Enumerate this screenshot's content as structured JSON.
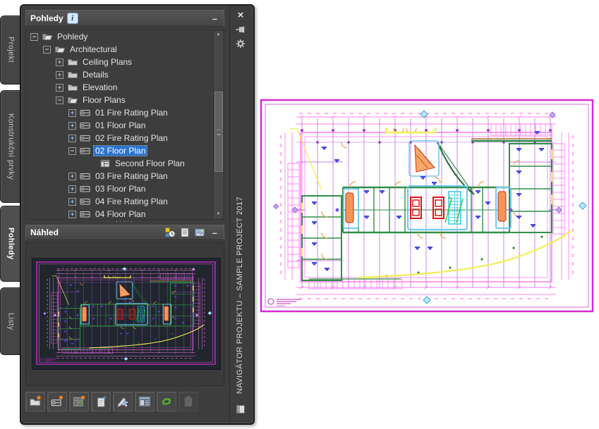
{
  "glyphs": {
    "plus": "+",
    "minus": "−",
    "collapse": "–",
    "splitter": "·····",
    "scroll_up": "▲",
    "scroll_down": "▼",
    "close": "×",
    "info": "i"
  },
  "palette": {
    "header": {
      "title": "Pohledy"
    },
    "side_tabs": [
      {
        "label": "Projekt"
      },
      {
        "label": "Konstrukční prvky"
      },
      {
        "label": "Pohledy"
      },
      {
        "label": "Listy"
      }
    ],
    "active_tab": "Pohledy",
    "title_strip": {
      "text": "NAVIGÁTOR PROJEKTU – SAMPLE PROJECT 2017",
      "icons": [
        "close-icon",
        "pin-icon",
        "gear-icon",
        "autohide-icon"
      ]
    },
    "tree": {
      "items": [
        {
          "label": "Pohledy",
          "level": 0,
          "expander": "minus",
          "icon": "folder-open"
        },
        {
          "label": "Architectural",
          "level": 1,
          "expander": "minus",
          "icon": "folder-open"
        },
        {
          "label": "Ceiling Plans",
          "level": 2,
          "expander": "plus",
          "icon": "folder-closed"
        },
        {
          "label": "Details",
          "level": 2,
          "expander": "plus",
          "icon": "folder-closed"
        },
        {
          "label": "Elevation",
          "level": 2,
          "expander": "plus",
          "icon": "folder-closed"
        },
        {
          "label": "Floor Plans",
          "level": 2,
          "expander": "minus",
          "icon": "folder-open"
        },
        {
          "label": "01 Fire Rating Plan",
          "level": 3,
          "expander": "plus",
          "icon": "view-drawing"
        },
        {
          "label": "01 Floor Plan",
          "level": 3,
          "expander": "plus",
          "icon": "view-drawing"
        },
        {
          "label": "02 Fire Rating Plan",
          "level": 3,
          "expander": "plus",
          "icon": "view-drawing"
        },
        {
          "label": "02 Floor Plan",
          "level": 3,
          "expander": "minus",
          "icon": "view-drawing",
          "selected": true
        },
        {
          "label": "Second Floor Plan",
          "level": 4,
          "expander": "none",
          "icon": "model-view"
        },
        {
          "label": "03 Fire Rating Plan",
          "level": 3,
          "expander": "plus",
          "icon": "view-drawing"
        },
        {
          "label": "03 Floor Plan",
          "level": 3,
          "expander": "plus",
          "icon": "view-drawing"
        },
        {
          "label": "04 Fire Rating Plan",
          "level": 3,
          "expander": "plus",
          "icon": "view-drawing"
        },
        {
          "label": "04 Floor Plan",
          "level": 3,
          "expander": "plus",
          "icon": "view-drawing"
        }
      ]
    },
    "preview": {
      "title": "Náhled",
      "toolbar_icons": [
        "refresh-preview-icon",
        "document-view-icon",
        "image-preview-icon"
      ]
    },
    "toolbar": {
      "buttons": [
        {
          "icon": "new-category-icon"
        },
        {
          "icon": "new-view-icon"
        },
        {
          "icon": "new-model-view-icon"
        },
        {
          "icon": "new-sheet-icon"
        },
        {
          "icon": "edit-view-icon"
        },
        {
          "icon": "details-icon"
        },
        {
          "icon": "refresh-icon",
          "color": "#5fb82e"
        },
        {
          "icon": "repath-icon",
          "disabled": true
        }
      ]
    }
  },
  "drawing": {
    "description": "Second Floor Plan drawing sheet preview",
    "colors": {
      "sheet_border": "#d42bd4",
      "grid": "#b45ae0",
      "dimension": "#ff80ec",
      "walls": "#2f8f46",
      "core_outline": "#74c8f2",
      "elevator": "#e01515",
      "stair": "#22c8e0",
      "doors": "#f0a050",
      "fixtures": "#4848e0",
      "accent": "#f2ee55",
      "preview_background": "#20262e"
    }
  }
}
